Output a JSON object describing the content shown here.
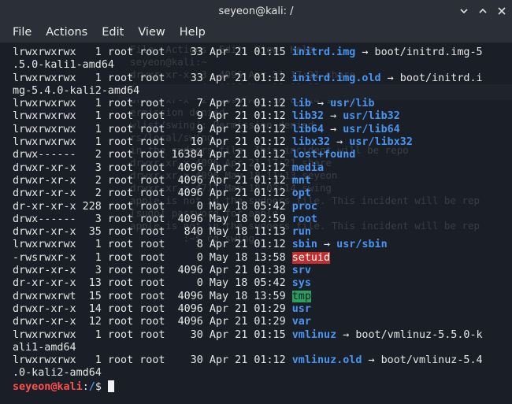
{
  "window": {
    "title": "seyeon@kali: /",
    "controls": [
      "minimize",
      "maximize",
      "close"
    ]
  },
  "menu": [
    "File",
    "Actions",
    "Edit",
    "View",
    "Help"
  ],
  "ghost_lines": [
    "  File  Actions  Edit  View  Help",
    "",
    "  seyeon@kali:~",
    "",
    "  drwxr-xr-x  3  4096 Apr 21 17:21 share",
    "  drwxr-xr-x  4  4096 May 18 11:13 seyeon",
    "  drwxr-xr-x  2  4096 May 18 03:14 swing",
    "",
    "  ermission denied",
    "",
    "  wlist/swing': Permission denied",
    "  rs/local/swing",
    "",
    "  in the sudoers file. This incident will be repo",
    "",
    "",
    "  drwxr-xr-x 4096 Apr 21 17:21 share",
    "  drwxr-xr-x 4096 May 18 11:13 seyeon",
    "  drwxr-xr-x 4711 May 18 03:14 swing",
    "",
    "  apple is not in the sudoers file. This incident will be rep",
    "  [sudo] password for apple:",
    "  apple is not in the sudoers file. This incident will be rep",
    "           :~$ cd swing"
  ],
  "lines": [
    [
      {
        "t": "lrwxrwxrwx   1 root root    33 Apr 21 01:15 "
      },
      {
        "t": "initrd.img",
        "c": "blue"
      },
      {
        "t": " → boot/initrd.img-5"
      }
    ],
    [
      {
        "t": ".5.0-kali1-amd64"
      }
    ],
    [
      {
        "t": "lrwxrwxrwx   1 root root    33 Apr 21 01:12 "
      },
      {
        "t": "initrd.img.old",
        "c": "blue"
      },
      {
        "t": " → boot/initrd.i"
      }
    ],
    [
      {
        "t": "mg-5.4.0-kali2-amd64"
      }
    ],
    [
      {
        "t": "lrwxrwxrwx   1 root root     7 Apr 21 01:12 "
      },
      {
        "t": "lib",
        "c": "blue"
      },
      {
        "t": " → "
      },
      {
        "t": "usr/lib",
        "c": "blue"
      }
    ],
    [
      {
        "t": "lrwxrwxrwx   1 root root     9 Apr 21 01:12 "
      },
      {
        "t": "lib32",
        "c": "blue"
      },
      {
        "t": " → "
      },
      {
        "t": "usr/lib32",
        "c": "blue"
      }
    ],
    [
      {
        "t": "lrwxrwxrwx   1 root root     9 Apr 21 01:12 "
      },
      {
        "t": "lib64",
        "c": "blue"
      },
      {
        "t": " → "
      },
      {
        "t": "usr/lib64",
        "c": "blue"
      }
    ],
    [
      {
        "t": "lrwxrwxrwx   1 root root    10 Apr 21 01:12 "
      },
      {
        "t": "libx32",
        "c": "blue"
      },
      {
        "t": " → "
      },
      {
        "t": "usr/libx32",
        "c": "blue"
      }
    ],
    [
      {
        "t": "drwx------   2 root root 16384 Apr 21 01:12 "
      },
      {
        "t": "lost+found",
        "c": "blue"
      }
    ],
    [
      {
        "t": "drwxr-xr-x   3 root root  4096 Apr 21 01:12 "
      },
      {
        "t": "media",
        "c": "blue"
      }
    ],
    [
      {
        "t": "drwxr-xr-x   2 root root  4096 Apr 21 01:12 "
      },
      {
        "t": "mnt",
        "c": "blue"
      }
    ],
    [
      {
        "t": "drwxr-xr-x   2 root root  4096 Apr 21 01:12 "
      },
      {
        "t": "opt",
        "c": "blue"
      }
    ],
    [
      {
        "t": "dr-xr-xr-x 228 root root     0 May 18 05:42 "
      },
      {
        "t": "proc",
        "c": "blue"
      }
    ],
    [
      {
        "t": "drwx------   3 root root  4096 May 18 02:59 "
      },
      {
        "t": "root",
        "c": "blue"
      }
    ],
    [
      {
        "t": "drwxr-xr-x  35 root root   840 May 18 11:13 "
      },
      {
        "t": "run",
        "c": "blue"
      }
    ],
    [
      {
        "t": "lrwxrwxrwx   1 root root     8 Apr 21 01:12 "
      },
      {
        "t": "sbin",
        "c": "blue"
      },
      {
        "t": " → "
      },
      {
        "t": "usr/sbin",
        "c": "blue"
      }
    ],
    [
      {
        "t": "-rwsrwxr-x   1 root root     0 May 18 13:58 "
      },
      {
        "t": "setuid",
        "c": "suid"
      }
    ],
    [
      {
        "t": "drwxr-xr-x   3 root root  4096 Apr 21 01:38 "
      },
      {
        "t": "srv",
        "c": "blue"
      }
    ],
    [
      {
        "t": "dr-xr-xr-x  13 root root     0 May 18 05:42 "
      },
      {
        "t": "sys",
        "c": "blue"
      }
    ],
    [
      {
        "t": "drwxrwxrwt  15 root root  4096 May 18 13:59 "
      },
      {
        "t": "tmp",
        "c": "tmp"
      }
    ],
    [
      {
        "t": "drwxr-xr-x  14 root root  4096 Apr 21 01:29 "
      },
      {
        "t": "usr",
        "c": "blue"
      }
    ],
    [
      {
        "t": "drwxr-xr-x  12 root root  4096 Apr 21 01:29 "
      },
      {
        "t": "var",
        "c": "blue"
      }
    ],
    [
      {
        "t": "lrwxrwxrwx   1 root root    30 Apr 21 01:15 "
      },
      {
        "t": "vmlinuz",
        "c": "blue"
      },
      {
        "t": " → boot/vmlinuz-5.5.0-k"
      }
    ],
    [
      {
        "t": "ali1-amd64"
      }
    ],
    [
      {
        "t": "lrwxrwxrwx   1 root root    30 Apr 21 01:12 "
      },
      {
        "t": "vmlinuz.old",
        "c": "blue"
      },
      {
        "t": " → boot/vmlinuz-5.4"
      }
    ],
    [
      {
        "t": ".0-kali2-amd64"
      }
    ]
  ],
  "prompt": {
    "user_host": "seyeon@kali",
    "separator": ":",
    "path": "/",
    "symbol": "$ "
  },
  "colors": {
    "directory": "#4a95f0",
    "prompt_user": "#ff4f4f",
    "setuid_bg": "#c22d2d",
    "sticky_dir_bg": "#2aa15f"
  }
}
